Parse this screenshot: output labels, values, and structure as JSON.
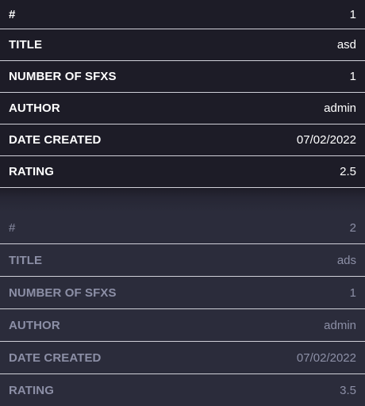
{
  "records": [
    {
      "rows": [
        {
          "label": "#",
          "value": "1"
        },
        {
          "label": "TITLE",
          "value": "asd"
        },
        {
          "label": "NUMBER OF SFXS",
          "value": "1"
        },
        {
          "label": "AUTHOR",
          "value": "admin"
        },
        {
          "label": "DATE CREATED",
          "value": "07/02/2022"
        },
        {
          "label": "RATING",
          "value": "2.5"
        }
      ]
    },
    {
      "rows": [
        {
          "label": "#",
          "value": "2"
        },
        {
          "label": "TITLE",
          "value": "ads"
        },
        {
          "label": "NUMBER OF SFXS",
          "value": "1"
        },
        {
          "label": "AUTHOR",
          "value": "admin"
        },
        {
          "label": "DATE CREATED",
          "value": "07/02/2022"
        },
        {
          "label": "RATING",
          "value": "3.5"
        }
      ]
    }
  ]
}
